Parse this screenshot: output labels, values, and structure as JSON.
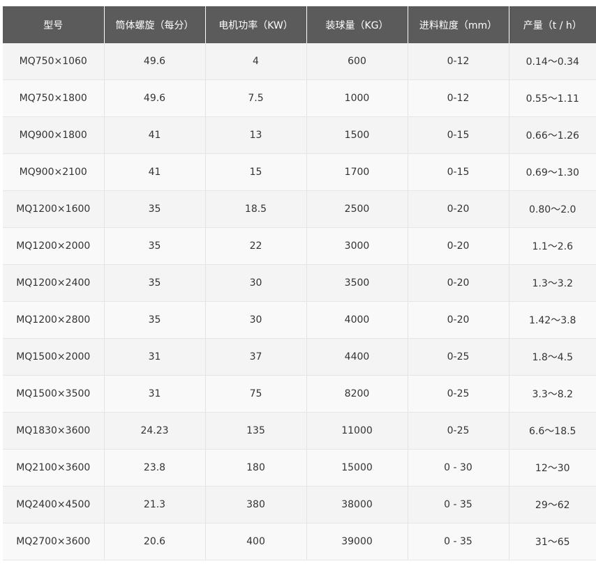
{
  "table": {
    "headers": [
      "型号",
      "筒体螺旋（每分）",
      "电机功率（KW）",
      "装球量（KG）",
      "进料粒度（mm）",
      "产量（t / h）"
    ],
    "rows": [
      [
        "MQ750×1060",
        "49.6",
        "4",
        "600",
        "0-12",
        "0.14～0.34"
      ],
      [
        "MQ750×1800",
        "49.6",
        "7.5",
        "1000",
        "0-12",
        "0.55～1.11"
      ],
      [
        "MQ900×1800",
        "41",
        "13",
        "1500",
        "0-15",
        "0.66～1.26"
      ],
      [
        "MQ900×2100",
        "41",
        "15",
        "1700",
        "0-15",
        "0.69～1.30"
      ],
      [
        "MQ1200×1600",
        "35",
        "18.5",
        "2500",
        "0-20",
        "0.80～2.0"
      ],
      [
        "MQ1200×2000",
        "35",
        "22",
        "3000",
        "0-20",
        "1.1～2.6"
      ],
      [
        "MQ1200×2400",
        "35",
        "30",
        "3500",
        "0-20",
        "1.3～3.2"
      ],
      [
        "MQ1200×2800",
        "35",
        "30",
        "4000",
        "0-20",
        "1.42～3.8"
      ],
      [
        "MQ1500×2000",
        "31",
        "37",
        "4400",
        "0-25",
        "1.8～4.5"
      ],
      [
        "MQ1500×3500",
        "31",
        "75",
        "8200",
        "0-25",
        "3.3～8.2"
      ],
      [
        "MQ1830×3600",
        "24.23",
        "135",
        "11000",
        "0-25",
        "6.6～18.5"
      ],
      [
        "MQ2100×3600",
        "23.8",
        "180",
        "15000",
        "0 - 30",
        "12～30"
      ],
      [
        "MQ2400×4500",
        "21.3",
        "380",
        "38000",
        "0 - 35",
        "29～62"
      ],
      [
        "MQ2700×3600",
        "20.6",
        "400",
        "39000",
        "0 - 35",
        "31～65"
      ]
    ]
  }
}
